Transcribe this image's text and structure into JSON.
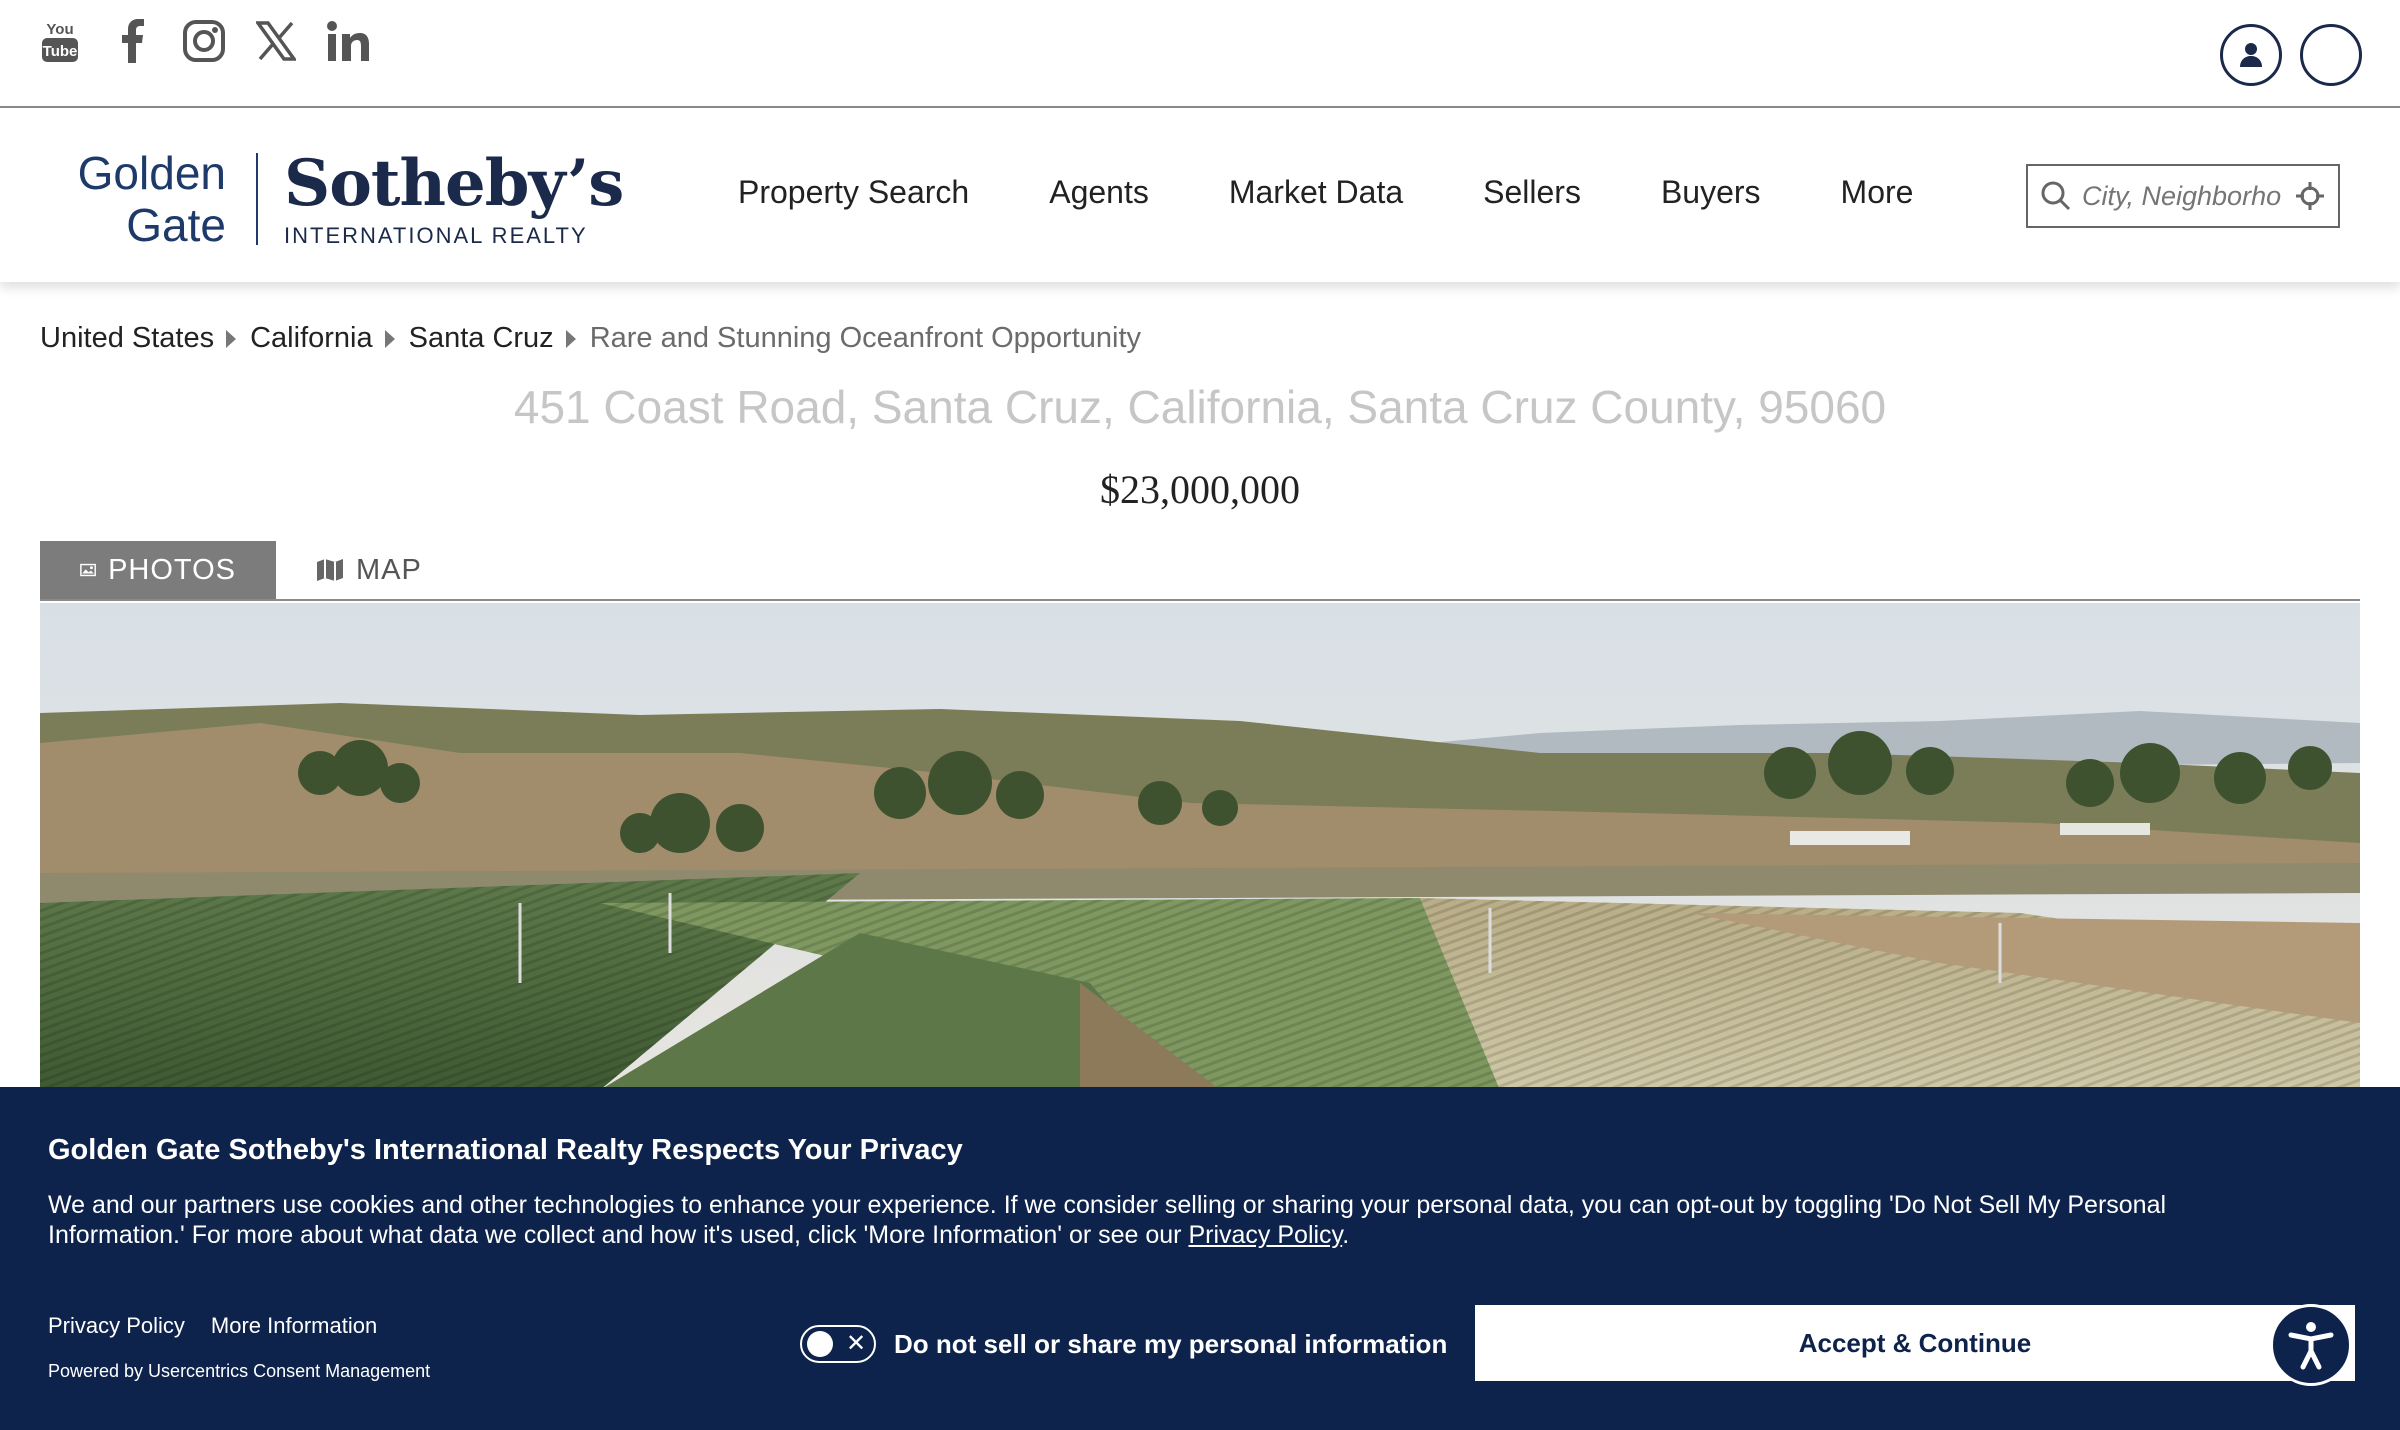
{
  "social": {
    "icons": [
      "youtube-icon",
      "facebook-icon",
      "instagram-icon",
      "x-icon",
      "linkedin-icon"
    ],
    "youtube_text_top": "You",
    "youtube_text_bottom": "Tube"
  },
  "logo": {
    "left_line1": "Golden",
    "left_line2": "Gate",
    "main": "Sotheby’s",
    "sub": "INTERNATIONAL REALTY"
  },
  "nav": {
    "items": [
      "Property Search",
      "Agents",
      "Market Data",
      "Sellers",
      "Buyers",
      "More"
    ]
  },
  "search": {
    "placeholder": "City, Neighborhood"
  },
  "breadcrumb": {
    "items": [
      "United States",
      "California",
      "Santa Cruz"
    ],
    "current": "Rare and Stunning Oceanfront Opportunity"
  },
  "listing": {
    "address": "451 Coast Road, Santa Cruz, California, Santa Cruz County, 95060",
    "price": "$23,000,000"
  },
  "tabs": {
    "photos": "PHOTOS",
    "map": "MAP"
  },
  "consent": {
    "title": "Golden Gate Sotheby's International Realty Respects Your Privacy",
    "body_part1": "We and our partners use cookies and other technologies to enhance your experience. If we consider selling or sharing your personal data, you can opt-out by toggling 'Do Not Sell My Personal Information.' For more about what data we collect and how it's used, click 'More Information' or see our ",
    "body_link": "Privacy Policy",
    "body_end": ".",
    "privacy_policy": "Privacy Policy",
    "more_information": "More Information",
    "powered_by": "Powered by Usercentrics Consent Management",
    "toggle_label": "Do not sell or share my personal information",
    "accept": "Accept & Continue"
  },
  "colors": {
    "navy": "#0d234b",
    "brand_blue": "#1b2a4a",
    "tab_active": "#7c7c7c"
  }
}
